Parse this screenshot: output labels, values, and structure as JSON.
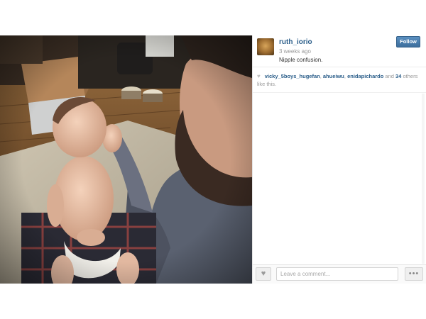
{
  "post": {
    "photo": {
      "description_icon": "photo-image"
    },
    "author": {
      "username": "ruth_iorio",
      "time_ago": "3 weeks ago",
      "avatar_icon": "avatar-image"
    },
    "follow_label": "Follow",
    "caption": "Nipple confusion.",
    "likes": {
      "heart_icon": "heart-icon",
      "likers": [
        "vicky_5boys_hugefan",
        "ahueiwu",
        "enidapichardo"
      ],
      "separator": ", ",
      "suffix_and": "and",
      "others_count": "34",
      "suffix_text": "others like this."
    },
    "comment_bar": {
      "like_icon": "heart-icon",
      "placeholder": "Leave a comment...",
      "more_icon": "ellipsis-icon",
      "more_label": "•••"
    }
  },
  "colors": {
    "link": "#2b5e8a",
    "follow_button": "#3d6e9c",
    "muted": "#999999"
  }
}
